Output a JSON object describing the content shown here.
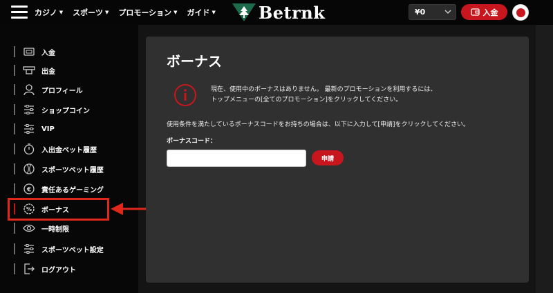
{
  "header": {
    "nav": [
      {
        "label": "カジノ"
      },
      {
        "label": "スポーツ"
      },
      {
        "label": "プロモーション"
      },
      {
        "label": "ガイド"
      }
    ],
    "brand": "Betrnk",
    "balance": "¥0",
    "deposit_label": "入金"
  },
  "sidebar": {
    "items": [
      {
        "label": "入金",
        "icon": "wallet-card-icon"
      },
      {
        "label": "出金",
        "icon": "cash-out-icon"
      },
      {
        "label": "プロフィール",
        "icon": "user-icon"
      },
      {
        "label": "ショップコイン",
        "icon": "sliders-icon"
      },
      {
        "label": "VIP",
        "icon": "sliders-icon"
      },
      {
        "label": "入出金ベット履歴",
        "icon": "stopwatch-icon"
      },
      {
        "label": "スポーツベット履歴",
        "icon": "ball-icon"
      },
      {
        "label": "責任あるゲーミング",
        "icon": "euro-chip-icon"
      },
      {
        "label": "ボーナス",
        "icon": "percent-badge-icon"
      },
      {
        "label": "一時制限",
        "icon": "eye-icon"
      },
      {
        "label": "スポーツベット設定",
        "icon": "sliders-icon"
      },
      {
        "label": "ログアウト",
        "icon": "logout-icon"
      }
    ],
    "active_index": 8
  },
  "main": {
    "title": "ボーナス",
    "info_line1": "現在、使用中のボーナスはありません。 最新のプロモーションを利用するには、",
    "info_line2": "トップメニューの[全てのプロモーション]をクリックしてください。",
    "description": "使用条件を満たしているボーナスコードをお持ちの場合は、以下に入力して[申請]をクリックしてください。",
    "code_label": "ボーナスコード：",
    "code_value": "",
    "apply_label": "申請"
  },
  "colors": {
    "accent": "#c8161e",
    "highlight": "#e0271a",
    "card": "#303030",
    "sidebar": "#070707"
  }
}
